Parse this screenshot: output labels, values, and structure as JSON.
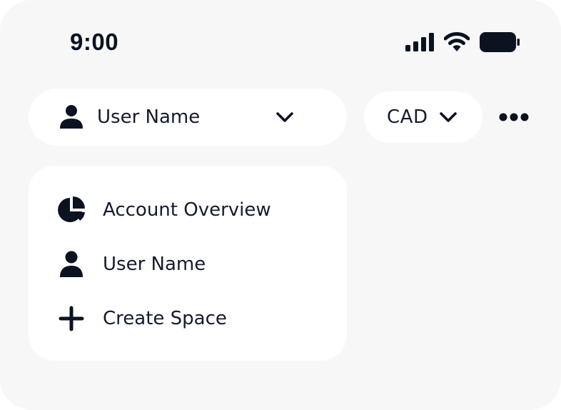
{
  "status_bar": {
    "time": "9:00",
    "icons": [
      "cellular-signal-icon",
      "wifi-icon",
      "battery-icon"
    ]
  },
  "header": {
    "user_selector": {
      "label": "User Name",
      "icon": "user-icon",
      "chevron": "chevron-down-icon"
    },
    "currency_selector": {
      "label": "CAD",
      "chevron": "chevron-down-icon"
    },
    "more": {
      "icon": "more-horizontal-icon"
    }
  },
  "dropdown": {
    "items": [
      {
        "label": "Account Overview",
        "icon": "pie-chart-icon"
      },
      {
        "label": "User Name",
        "icon": "user-icon"
      },
      {
        "label": "Create Space",
        "icon": "plus-icon"
      }
    ]
  },
  "colors": {
    "background": "#f7f7f7",
    "surface": "#ffffff",
    "text": "#141b2d",
    "icon": "#0b1220"
  }
}
